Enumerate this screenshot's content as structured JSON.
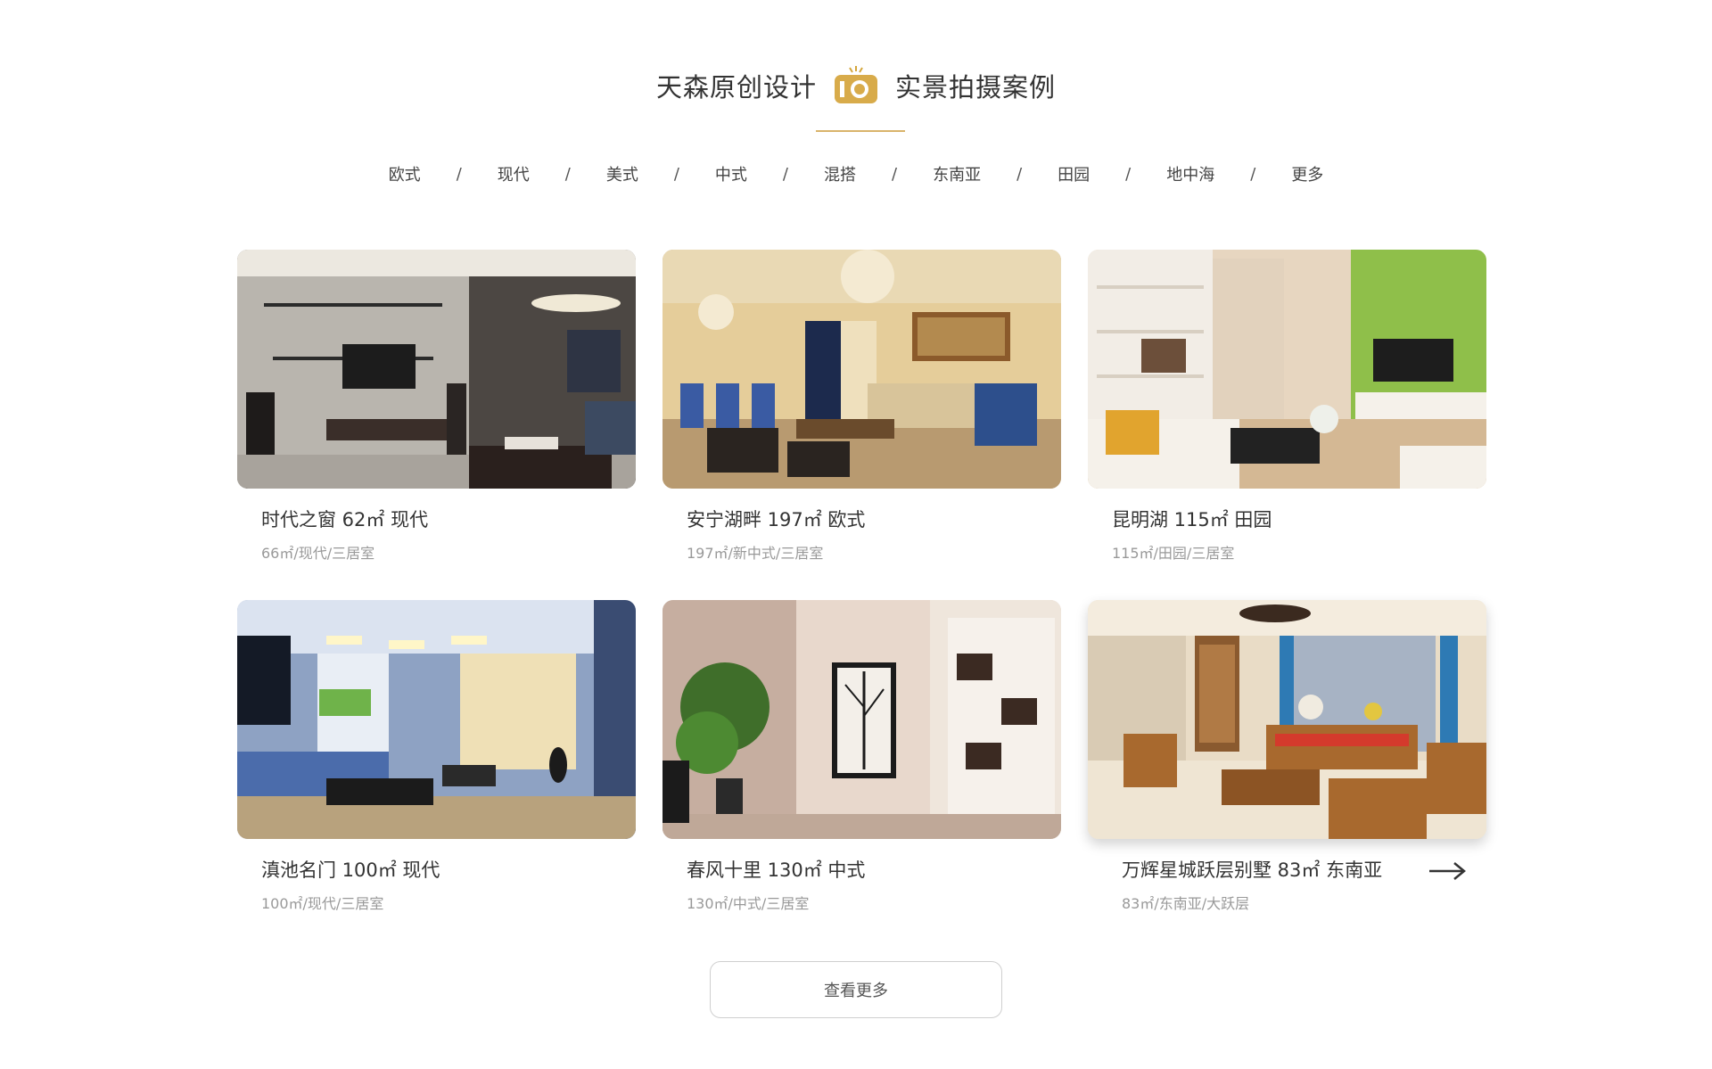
{
  "header": {
    "title_left": "天森原创设计",
    "title_right": "实景拍摄案例",
    "camera_icon": "camera-icon",
    "accent_color": "#d9b46b"
  },
  "categories": [
    "欧式",
    "现代",
    "美式",
    "中式",
    "混搭",
    "东南亚",
    "田园",
    "地中海",
    "更多"
  ],
  "separator": "/",
  "cases": [
    {
      "name": "时代之窗  62㎡  现代",
      "spec": "66㎡/现代/三居室"
    },
    {
      "name": "安宁湖畔  197㎡  欧式",
      "spec": "197㎡/新中式/三居室"
    },
    {
      "name": "昆明湖  115㎡  田园",
      "spec": "115㎡/田园/三居室"
    },
    {
      "name": "滇池名门  100㎡  现代",
      "spec": "100㎡/现代/三居室"
    },
    {
      "name": "春风十里  130㎡  中式",
      "spec": "130㎡/中式/三居室"
    },
    {
      "name": "万辉星城跃层别墅  83㎡  东南亚",
      "spec": "83㎡/东南亚/大跃层"
    }
  ],
  "more_button": "查看更多"
}
